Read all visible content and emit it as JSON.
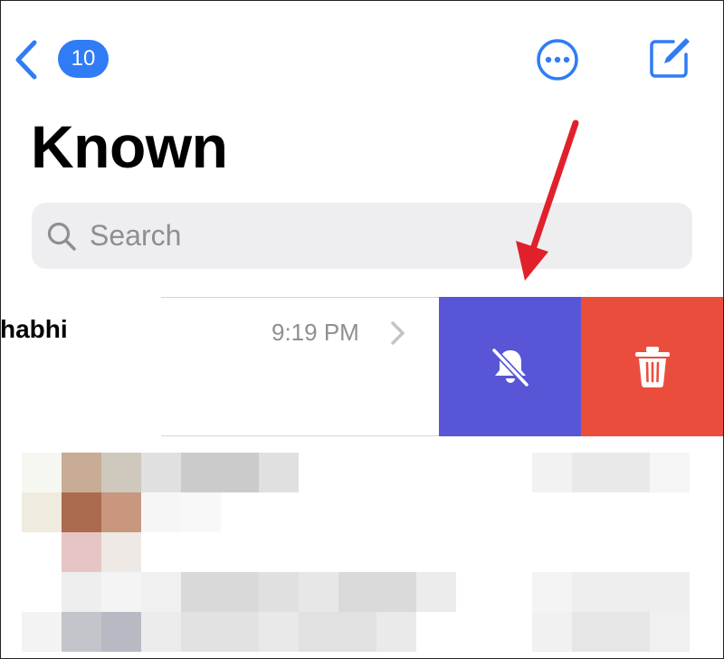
{
  "nav": {
    "unread_count": "10"
  },
  "page": {
    "title": "Known"
  },
  "search": {
    "placeholder": "Search"
  },
  "conversation": {
    "contact_name": "habhi",
    "time": "9:19 PM"
  },
  "swipe_actions": {
    "mute_icon": "bell-slash-icon",
    "delete_icon": "trash-icon",
    "mute_color": "#5856d6",
    "delete_color": "#eb4d3d"
  },
  "colors": {
    "accent": "#2f7cf6",
    "annotation_arrow": "#e0212b"
  }
}
